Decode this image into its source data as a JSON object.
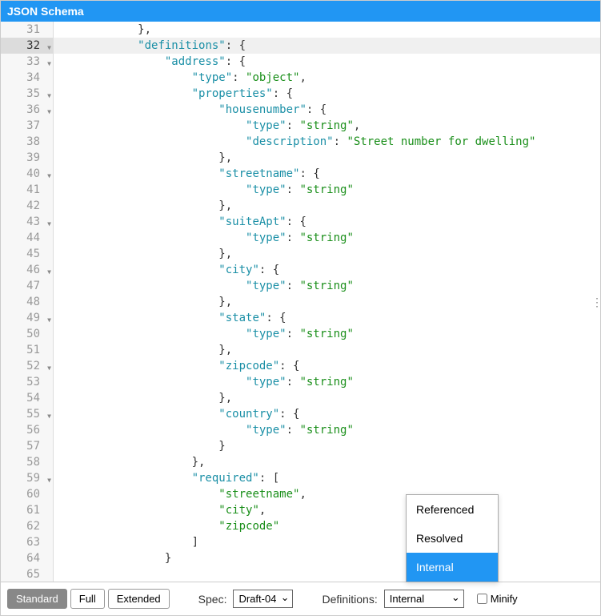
{
  "header": {
    "title": "JSON Schema"
  },
  "editor": {
    "active_line": 32,
    "lines": [
      {
        "n": 31,
        "fold": false,
        "tokens": [
          {
            "t": "punc",
            "v": "},"
          }
        ],
        "indent": 3
      },
      {
        "n": 32,
        "fold": true,
        "active": true,
        "tokens": [
          {
            "t": "key",
            "v": "\"definitions\""
          },
          {
            "t": "punc",
            "v": ": "
          },
          {
            "t": "brace",
            "v": "{"
          }
        ],
        "indent": 3
      },
      {
        "n": 33,
        "fold": true,
        "tokens": [
          {
            "t": "key",
            "v": "\"address\""
          },
          {
            "t": "punc",
            "v": ": "
          },
          {
            "t": "brace",
            "v": "{"
          }
        ],
        "indent": 4
      },
      {
        "n": 34,
        "fold": false,
        "tokens": [
          {
            "t": "key",
            "v": "\"type\""
          },
          {
            "t": "punc",
            "v": ": "
          },
          {
            "t": "str",
            "v": "\"object\""
          },
          {
            "t": "punc",
            "v": ","
          }
        ],
        "indent": 5
      },
      {
        "n": 35,
        "fold": true,
        "tokens": [
          {
            "t": "key",
            "v": "\"properties\""
          },
          {
            "t": "punc",
            "v": ": "
          },
          {
            "t": "brace",
            "v": "{"
          }
        ],
        "indent": 5
      },
      {
        "n": 36,
        "fold": true,
        "tokens": [
          {
            "t": "key",
            "v": "\"housenumber\""
          },
          {
            "t": "punc",
            "v": ": "
          },
          {
            "t": "brace",
            "v": "{"
          }
        ],
        "indent": 6
      },
      {
        "n": 37,
        "fold": false,
        "tokens": [
          {
            "t": "key",
            "v": "\"type\""
          },
          {
            "t": "punc",
            "v": ": "
          },
          {
            "t": "str",
            "v": "\"string\""
          },
          {
            "t": "punc",
            "v": ","
          }
        ],
        "indent": 7
      },
      {
        "n": 38,
        "fold": false,
        "tokens": [
          {
            "t": "key",
            "v": "\"description\""
          },
          {
            "t": "punc",
            "v": ": "
          },
          {
            "t": "str",
            "v": "\"Street number for dwelling\""
          }
        ],
        "indent": 7
      },
      {
        "n": 39,
        "fold": false,
        "tokens": [
          {
            "t": "brace",
            "v": "}"
          },
          {
            "t": "punc",
            "v": ","
          }
        ],
        "indent": 6
      },
      {
        "n": 40,
        "fold": true,
        "tokens": [
          {
            "t": "key",
            "v": "\"streetname\""
          },
          {
            "t": "punc",
            "v": ": "
          },
          {
            "t": "brace",
            "v": "{"
          }
        ],
        "indent": 6
      },
      {
        "n": 41,
        "fold": false,
        "tokens": [
          {
            "t": "key",
            "v": "\"type\""
          },
          {
            "t": "punc",
            "v": ": "
          },
          {
            "t": "str",
            "v": "\"string\""
          }
        ],
        "indent": 7
      },
      {
        "n": 42,
        "fold": false,
        "tokens": [
          {
            "t": "brace",
            "v": "}"
          },
          {
            "t": "punc",
            "v": ","
          }
        ],
        "indent": 6
      },
      {
        "n": 43,
        "fold": true,
        "tokens": [
          {
            "t": "key",
            "v": "\"suiteApt\""
          },
          {
            "t": "punc",
            "v": ": "
          },
          {
            "t": "brace",
            "v": "{"
          }
        ],
        "indent": 6
      },
      {
        "n": 44,
        "fold": false,
        "tokens": [
          {
            "t": "key",
            "v": "\"type\""
          },
          {
            "t": "punc",
            "v": ": "
          },
          {
            "t": "str",
            "v": "\"string\""
          }
        ],
        "indent": 7
      },
      {
        "n": 45,
        "fold": false,
        "tokens": [
          {
            "t": "brace",
            "v": "}"
          },
          {
            "t": "punc",
            "v": ","
          }
        ],
        "indent": 6
      },
      {
        "n": 46,
        "fold": true,
        "tokens": [
          {
            "t": "key",
            "v": "\"city\""
          },
          {
            "t": "punc",
            "v": ": "
          },
          {
            "t": "brace",
            "v": "{"
          }
        ],
        "indent": 6
      },
      {
        "n": 47,
        "fold": false,
        "tokens": [
          {
            "t": "key",
            "v": "\"type\""
          },
          {
            "t": "punc",
            "v": ": "
          },
          {
            "t": "str",
            "v": "\"string\""
          }
        ],
        "indent": 7
      },
      {
        "n": 48,
        "fold": false,
        "tokens": [
          {
            "t": "brace",
            "v": "}"
          },
          {
            "t": "punc",
            "v": ","
          }
        ],
        "indent": 6
      },
      {
        "n": 49,
        "fold": true,
        "tokens": [
          {
            "t": "key",
            "v": "\"state\""
          },
          {
            "t": "punc",
            "v": ": "
          },
          {
            "t": "brace",
            "v": "{"
          }
        ],
        "indent": 6
      },
      {
        "n": 50,
        "fold": false,
        "tokens": [
          {
            "t": "key",
            "v": "\"type\""
          },
          {
            "t": "punc",
            "v": ": "
          },
          {
            "t": "str",
            "v": "\"string\""
          }
        ],
        "indent": 7
      },
      {
        "n": 51,
        "fold": false,
        "tokens": [
          {
            "t": "brace",
            "v": "}"
          },
          {
            "t": "punc",
            "v": ","
          }
        ],
        "indent": 6
      },
      {
        "n": 52,
        "fold": true,
        "tokens": [
          {
            "t": "key",
            "v": "\"zipcode\""
          },
          {
            "t": "punc",
            "v": ": "
          },
          {
            "t": "brace",
            "v": "{"
          }
        ],
        "indent": 6
      },
      {
        "n": 53,
        "fold": false,
        "tokens": [
          {
            "t": "key",
            "v": "\"type\""
          },
          {
            "t": "punc",
            "v": ": "
          },
          {
            "t": "str",
            "v": "\"string\""
          }
        ],
        "indent": 7
      },
      {
        "n": 54,
        "fold": false,
        "tokens": [
          {
            "t": "brace",
            "v": "}"
          },
          {
            "t": "punc",
            "v": ","
          }
        ],
        "indent": 6
      },
      {
        "n": 55,
        "fold": true,
        "tokens": [
          {
            "t": "key",
            "v": "\"country\""
          },
          {
            "t": "punc",
            "v": ": "
          },
          {
            "t": "brace",
            "v": "{"
          }
        ],
        "indent": 6
      },
      {
        "n": 56,
        "fold": false,
        "tokens": [
          {
            "t": "key",
            "v": "\"type\""
          },
          {
            "t": "punc",
            "v": ": "
          },
          {
            "t": "str",
            "v": "\"string\""
          }
        ],
        "indent": 7
      },
      {
        "n": 57,
        "fold": false,
        "tokens": [
          {
            "t": "brace",
            "v": "}"
          }
        ],
        "indent": 6
      },
      {
        "n": 58,
        "fold": false,
        "tokens": [
          {
            "t": "brace",
            "v": "}"
          },
          {
            "t": "punc",
            "v": ","
          }
        ],
        "indent": 5
      },
      {
        "n": 59,
        "fold": true,
        "tokens": [
          {
            "t": "key",
            "v": "\"required\""
          },
          {
            "t": "punc",
            "v": ": "
          },
          {
            "t": "brace",
            "v": "["
          }
        ],
        "indent": 5
      },
      {
        "n": 60,
        "fold": false,
        "tokens": [
          {
            "t": "str",
            "v": "\"streetname\""
          },
          {
            "t": "punc",
            "v": ","
          }
        ],
        "indent": 6
      },
      {
        "n": 61,
        "fold": false,
        "tokens": [
          {
            "t": "str",
            "v": "\"city\""
          },
          {
            "t": "punc",
            "v": ","
          }
        ],
        "indent": 6
      },
      {
        "n": 62,
        "fold": false,
        "tokens": [
          {
            "t": "str",
            "v": "\"zipcode\""
          }
        ],
        "indent": 6
      },
      {
        "n": 63,
        "fold": false,
        "tokens": [
          {
            "t": "brace",
            "v": "]"
          }
        ],
        "indent": 5
      },
      {
        "n": 64,
        "fold": false,
        "tokens": [
          {
            "t": "brace",
            "v": "}"
          }
        ],
        "indent": 4
      },
      {
        "n": 65,
        "fold": false,
        "tokens": [],
        "indent": 0
      }
    ]
  },
  "toolbar": {
    "buttons": {
      "standard": "Standard",
      "full": "Full",
      "extended": "Extended"
    },
    "spec_label": "Spec:",
    "spec_value": "Draft-04",
    "definitions_label": "Definitions:",
    "definitions_value": "Internal",
    "minify_label": "Minify",
    "minify_checked": false
  },
  "dropdown": {
    "items": [
      "Referenced",
      "Resolved",
      "Internal"
    ],
    "selected": "Internal"
  }
}
